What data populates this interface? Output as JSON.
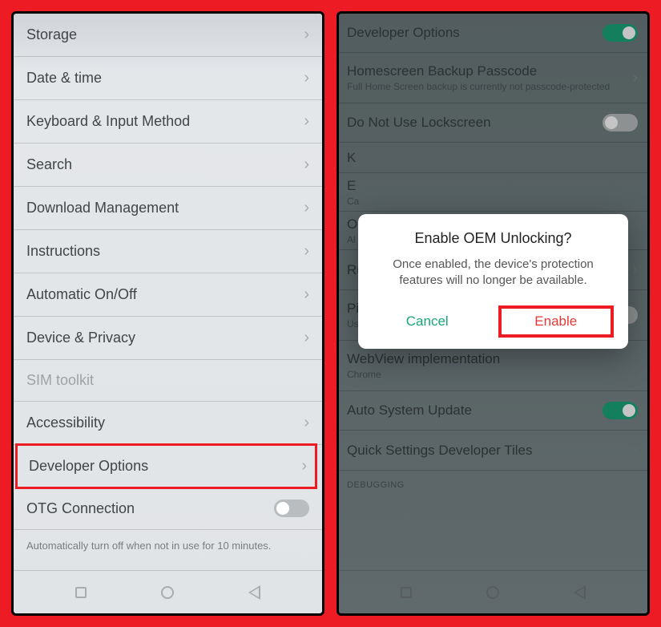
{
  "left": {
    "items": [
      {
        "label": "Storage",
        "chev": true
      },
      {
        "label": "Date & time",
        "chev": true
      },
      {
        "label": "Keyboard & Input Method",
        "chev": true
      },
      {
        "label": "Search",
        "chev": true
      },
      {
        "label": "Download Management",
        "chev": true
      },
      {
        "label": "Instructions",
        "chev": true
      },
      {
        "label": "Automatic On/Off",
        "chev": true
      },
      {
        "label": "Device & Privacy",
        "chev": true
      },
      {
        "label": "SIM toolkit",
        "chev": false,
        "disabled": true
      },
      {
        "label": "Accessibility",
        "chev": true
      },
      {
        "label": "Developer Options",
        "chev": true,
        "highlight": true
      },
      {
        "label": "OTG Connection",
        "toggle": "off"
      }
    ],
    "footnote": "Automatically turn off when not in use for 10 minutes."
  },
  "right": {
    "items": [
      {
        "label": "Developer Options",
        "toggle": "on"
      },
      {
        "label": "Homescreen Backup Passcode",
        "sub": "Full Home Screen backup is currently not passcode-protected",
        "chev": true
      },
      {
        "label": "Do Not Use Lockscreen",
        "toggle": "off"
      },
      {
        "label": "K"
      },
      {
        "label": "E",
        "sub": "Ca"
      },
      {
        "label": "O",
        "sub": "Al"
      },
      {
        "label": "Running Services",
        "chev": true
      },
      {
        "label": "Picture colour mode",
        "sub": "Use sRGB",
        "toggle": "off"
      },
      {
        "label": "WebView implementation",
        "sub": "Chrome"
      },
      {
        "label": "Auto System Update",
        "toggle": "on"
      },
      {
        "label": "Quick Settings Developer Tiles",
        "chev": true
      }
    ],
    "section_debug": "DEBUGGING",
    "dialog": {
      "title": "Enable OEM Unlocking?",
      "message": "Once enabled, the device's protection features will no longer be available.",
      "cancel": "Cancel",
      "enable": "Enable"
    }
  }
}
